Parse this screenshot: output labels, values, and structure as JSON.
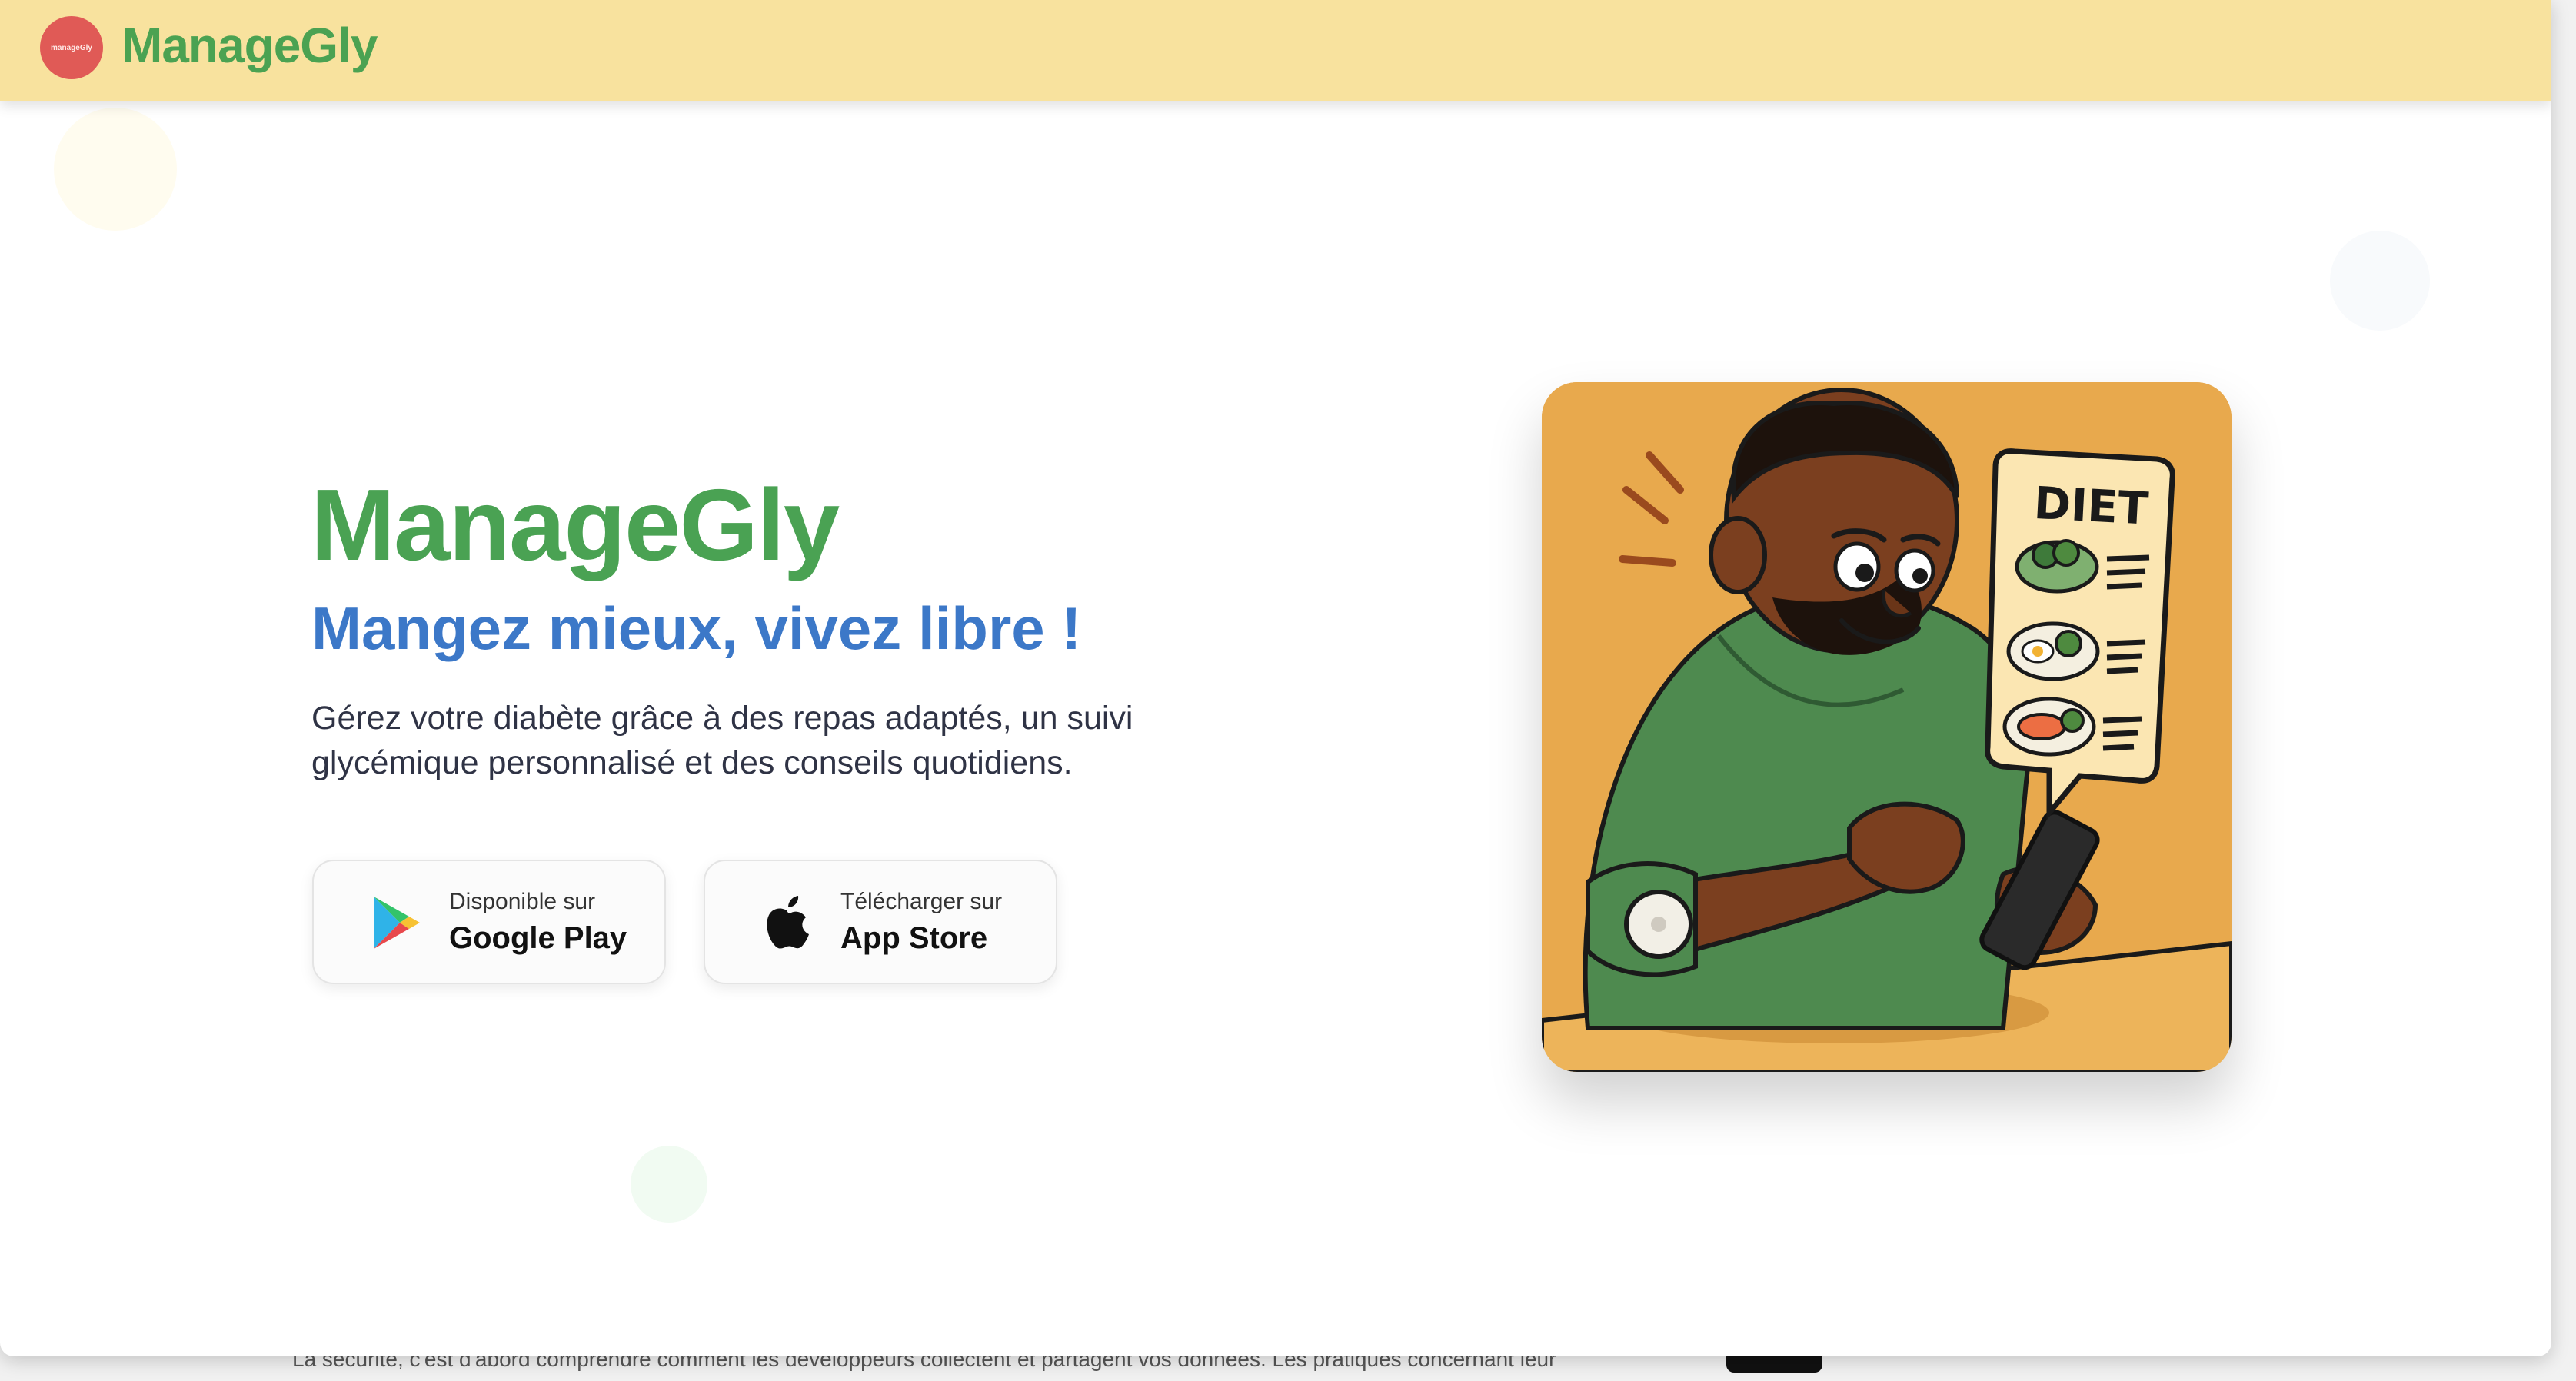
{
  "navbar": {
    "logo_text": "manageGly",
    "brand": "ManageGly",
    "background": "#f8e29e"
  },
  "hero": {
    "title": "ManageGly",
    "subtitle": "Mangez mieux, vivez libre !",
    "description": "Gérez votre diabète grâce à des repas adaptés, un suivi glycémique personnalisé et des conseils quotidiens."
  },
  "store_buttons": {
    "google": {
      "small": "Disponible sur",
      "big": "Google Play",
      "icon": "google-play-icon"
    },
    "apple": {
      "small": "Télécharger sur",
      "big": "App Store",
      "icon": "apple-icon"
    }
  },
  "illustration": {
    "sign_text": "DIET",
    "background": "#e8a94d"
  },
  "backdrop": {
    "text": "La sécurité, c'est d'abord comprendre comment les développeurs collectent et partagent vos données. Les pratiques concernant leur"
  },
  "colors": {
    "brand_green": "#4aa253",
    "accent_blue": "#3c78c8",
    "logo_red": "#e05a56"
  }
}
